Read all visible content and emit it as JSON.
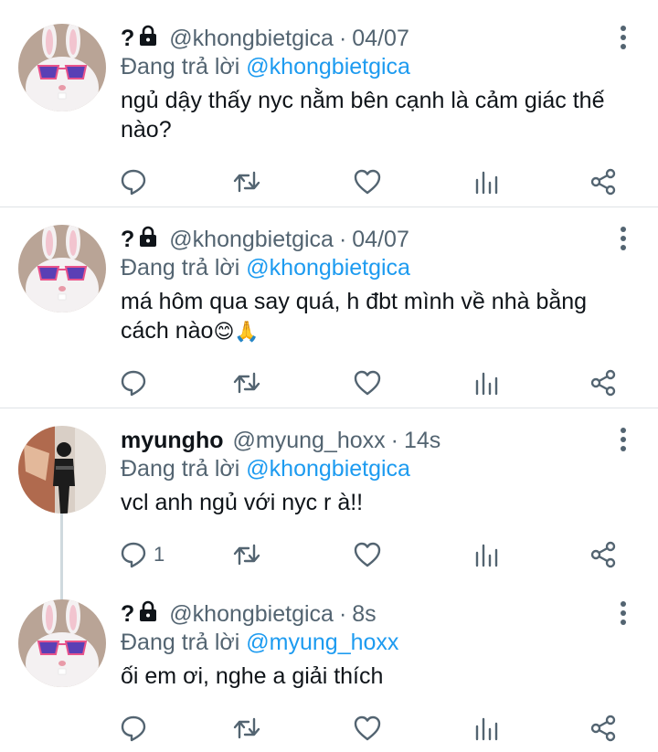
{
  "tweets": [
    {
      "name": "?",
      "handle": "@khongbietgica",
      "time": "04/07",
      "reply_prefix": "Đang trả lời",
      "reply_to": "@khongbietgica",
      "text": "ngủ dậy thấy nyc nằm bên cạnh là cảm giác thế nào?",
      "emoji": "",
      "reply_count": ""
    },
    {
      "name": "?",
      "handle": "@khongbietgica",
      "time": "04/07",
      "reply_prefix": "Đang trả lời",
      "reply_to": "@khongbietgica",
      "text": "má hôm qua say quá, h đbt mình về nhà bằng cách nào",
      "emoji": "😊🙏",
      "reply_count": ""
    },
    {
      "name": "myungho",
      "handle": "@myung_hoxx",
      "time": "14s",
      "reply_prefix": "Đang trả lời",
      "reply_to": "@khongbietgica",
      "text": "vcl anh ngủ với nyc r à!!",
      "emoji": "",
      "reply_count": "1"
    },
    {
      "name": "?",
      "handle": "@khongbietgica",
      "time": "8s",
      "reply_prefix": "Đang trả lời",
      "reply_to": "@myung_hoxx",
      "text": "ối em ơi, nghe a giải thích",
      "emoji": "",
      "reply_count": ""
    }
  ],
  "separator": "·",
  "icons": [
    "lock-icon",
    "more-vertical-icon",
    "reply-icon",
    "retweet-icon",
    "like-icon",
    "analytics-icon",
    "share-icon"
  ],
  "colors": {
    "accent": "#1d9bf0",
    "muted": "#536471",
    "text": "#0f1419",
    "divider": "#dfe3e6"
  }
}
